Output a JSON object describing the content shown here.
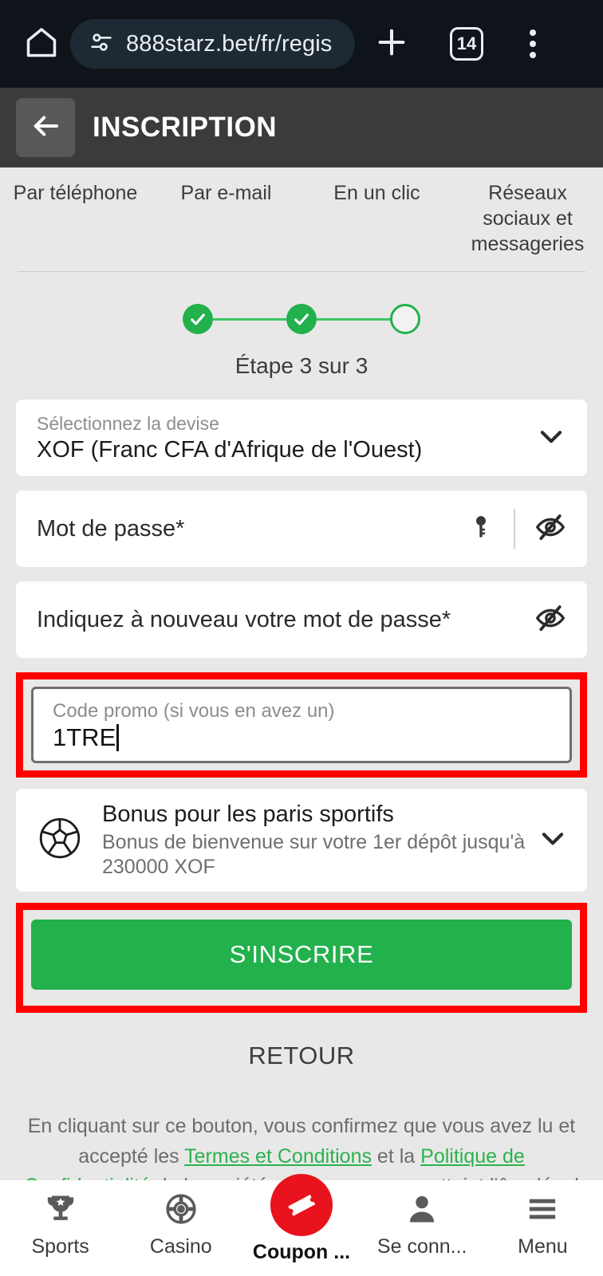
{
  "browser": {
    "home_icon": "home-icon",
    "site_settings_icon": "tune-icon",
    "url": "888starz.bet/fr/regis",
    "new_tab_icon": "plus-icon",
    "tab_count": "14",
    "overflow_icon": "more-vertical-icon"
  },
  "header": {
    "back_icon": "arrow-left-icon",
    "title": "INSCRIPTION"
  },
  "tabs": [
    {
      "label": "Par téléphone"
    },
    {
      "label": "Par e-mail"
    },
    {
      "label": "En un clic"
    },
    {
      "label": "Réseaux sociaux et messageries"
    }
  ],
  "stepper": {
    "steps": [
      {
        "state": "done"
      },
      {
        "state": "done"
      },
      {
        "state": "todo"
      }
    ],
    "label": "Étape 3 sur 3",
    "active_color": "#22b14c"
  },
  "form": {
    "currency": {
      "label": "Sélectionnez la devise",
      "value": "XOF  (Franc CFA d'Afrique de l'Ouest)",
      "chevron_icon": "chevron-down-icon"
    },
    "password": {
      "placeholder": "Mot de passe*",
      "key_icon": "key-icon",
      "visibility_icon": "eye-off-icon"
    },
    "password_confirm": {
      "placeholder": "Indiquez à nouveau votre mot de passe*",
      "visibility_icon": "eye-off-icon"
    },
    "promo": {
      "label": "Code promo (si vous en avez un)",
      "value": "1TRE",
      "highlight_color": "#ff0000"
    },
    "bonus": {
      "icon": "soccer-ball-icon",
      "title": "Bonus pour les paris sportifs",
      "description": "Bonus de bienvenue sur votre 1er dépôt jusqu'à 230000 XOF",
      "chevron_icon": "chevron-down-icon"
    },
    "submit_label": "S'INSCRIRE",
    "submit_color": "#22b14c",
    "back_label": "RETOUR"
  },
  "legal": {
    "prefix": "En cliquant sur ce bouton, vous confirmez que vous avez lu et accepté les ",
    "link1": "Termes et Conditions",
    "middle": " et la ",
    "link2": "Politique de Confidentialité",
    "suffix": " de la société et que vous avez atteint l'âge légal",
    "link_color": "#2bb24c"
  },
  "bottom_nav": [
    {
      "icon": "trophy-icon",
      "label": "Sports"
    },
    {
      "icon": "casino-chip-icon",
      "label": "Casino"
    },
    {
      "icon": "coupon-ticket-icon",
      "label": "Coupon ..."
    },
    {
      "icon": "person-icon",
      "label": "Se conn..."
    },
    {
      "icon": "hamburger-icon",
      "label": "Menu"
    }
  ]
}
